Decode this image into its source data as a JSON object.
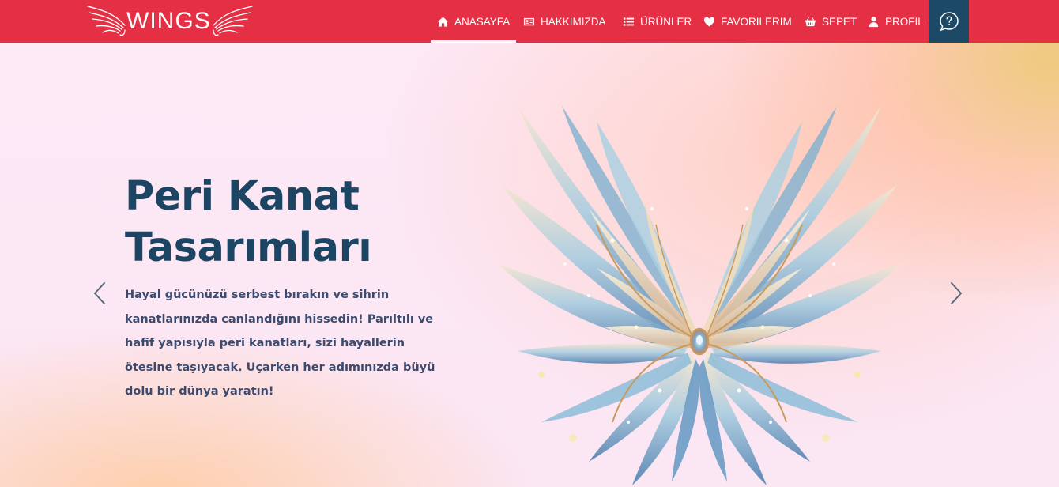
{
  "brand": {
    "name": "WINGS"
  },
  "nav": {
    "items": [
      {
        "label": "ANASAYFA",
        "icon": "home-icon",
        "active": true
      },
      {
        "label": "HAKKIMIZDA",
        "icon": "id-card-icon",
        "active": false
      },
      {
        "label": "ÜRÜNLER",
        "icon": "list-icon",
        "active": false
      },
      {
        "label": "FAVORILERIM",
        "icon": "heart-icon",
        "active": false
      },
      {
        "label": "SEPET",
        "icon": "basket-icon",
        "active": false
      },
      {
        "label": "PROFIL",
        "icon": "user-icon",
        "active": false
      }
    ],
    "help_icon": "question-bubble-icon"
  },
  "hero": {
    "title": "Peri Kanat Tasarımları",
    "description": "Hayal gücünüzü serbest bırakın ve sihrin kanatlarınızda canlandığını hissedin! Parıltılı ve hafif yapısıyla peri kanatları, sizi hayallerin ötesine taşıyacak. Uçarken her adımınızda büyü dolu bir dünya yaratın!",
    "prev_icon": "chevron-left-icon",
    "next_icon": "chevron-right-icon",
    "image_icon": "fairy-wings-illustration"
  },
  "colors": {
    "navbar": "#e52f44",
    "help_button": "#1c4a66",
    "title": "#1b4563",
    "text": "#3b4a6e"
  }
}
